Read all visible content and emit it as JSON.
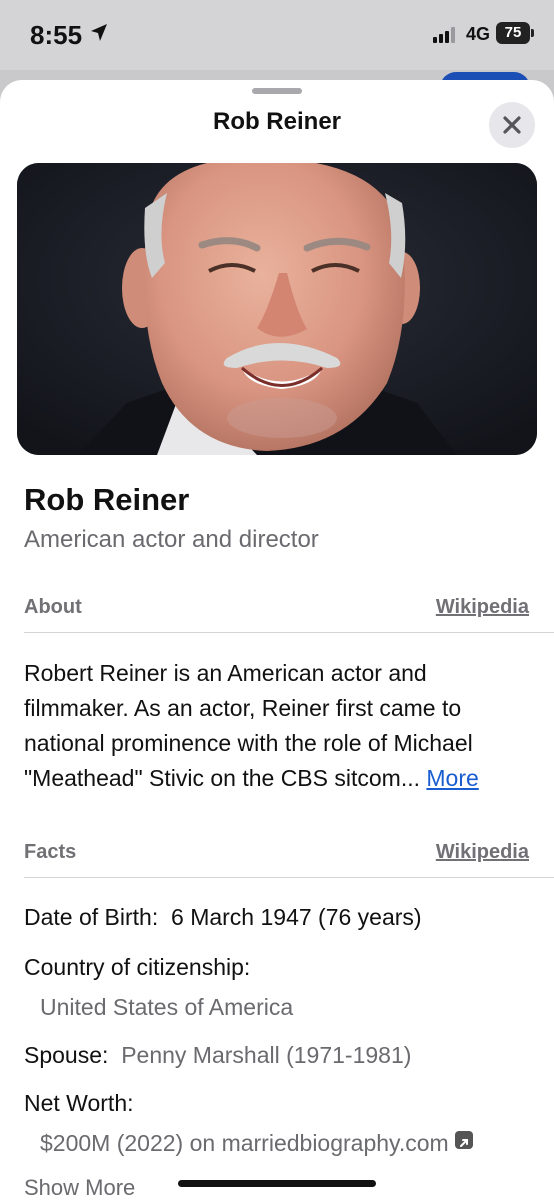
{
  "status_bar": {
    "time": "8:55",
    "network": "4G",
    "battery": "75"
  },
  "sheet": {
    "title": "Rob Reiner"
  },
  "entity": {
    "name": "Rob Reiner",
    "description": "American actor and director"
  },
  "about": {
    "heading": "About",
    "source": "Wikipedia",
    "text": "Robert Reiner is an American actor and filmmaker. As an actor, Reiner first came to national prominence with the role of Michael \"Meathead\" Stivic on the CBS sitcom...",
    "more_label": "More"
  },
  "facts": {
    "heading": "Facts",
    "source": "Wikipedia",
    "date_of_birth_label": "Date of Birth:",
    "date_of_birth_value": "6 March 1947 (76 years)",
    "citizenship_label": "Country of citizenship:",
    "citizenship_value": "United States of America",
    "spouse_label": "Spouse:",
    "spouse_value": "Penny Marshall (1971-1981)",
    "net_worth_label": "Net Worth:",
    "net_worth_value": "$200M (2022) on marriedbiography.com"
  },
  "show_more_label": "Show More",
  "colors": {
    "link": "#1a5dd0",
    "secondary_text": "#6a6a6f",
    "sheet_bg": "#ffffff"
  }
}
